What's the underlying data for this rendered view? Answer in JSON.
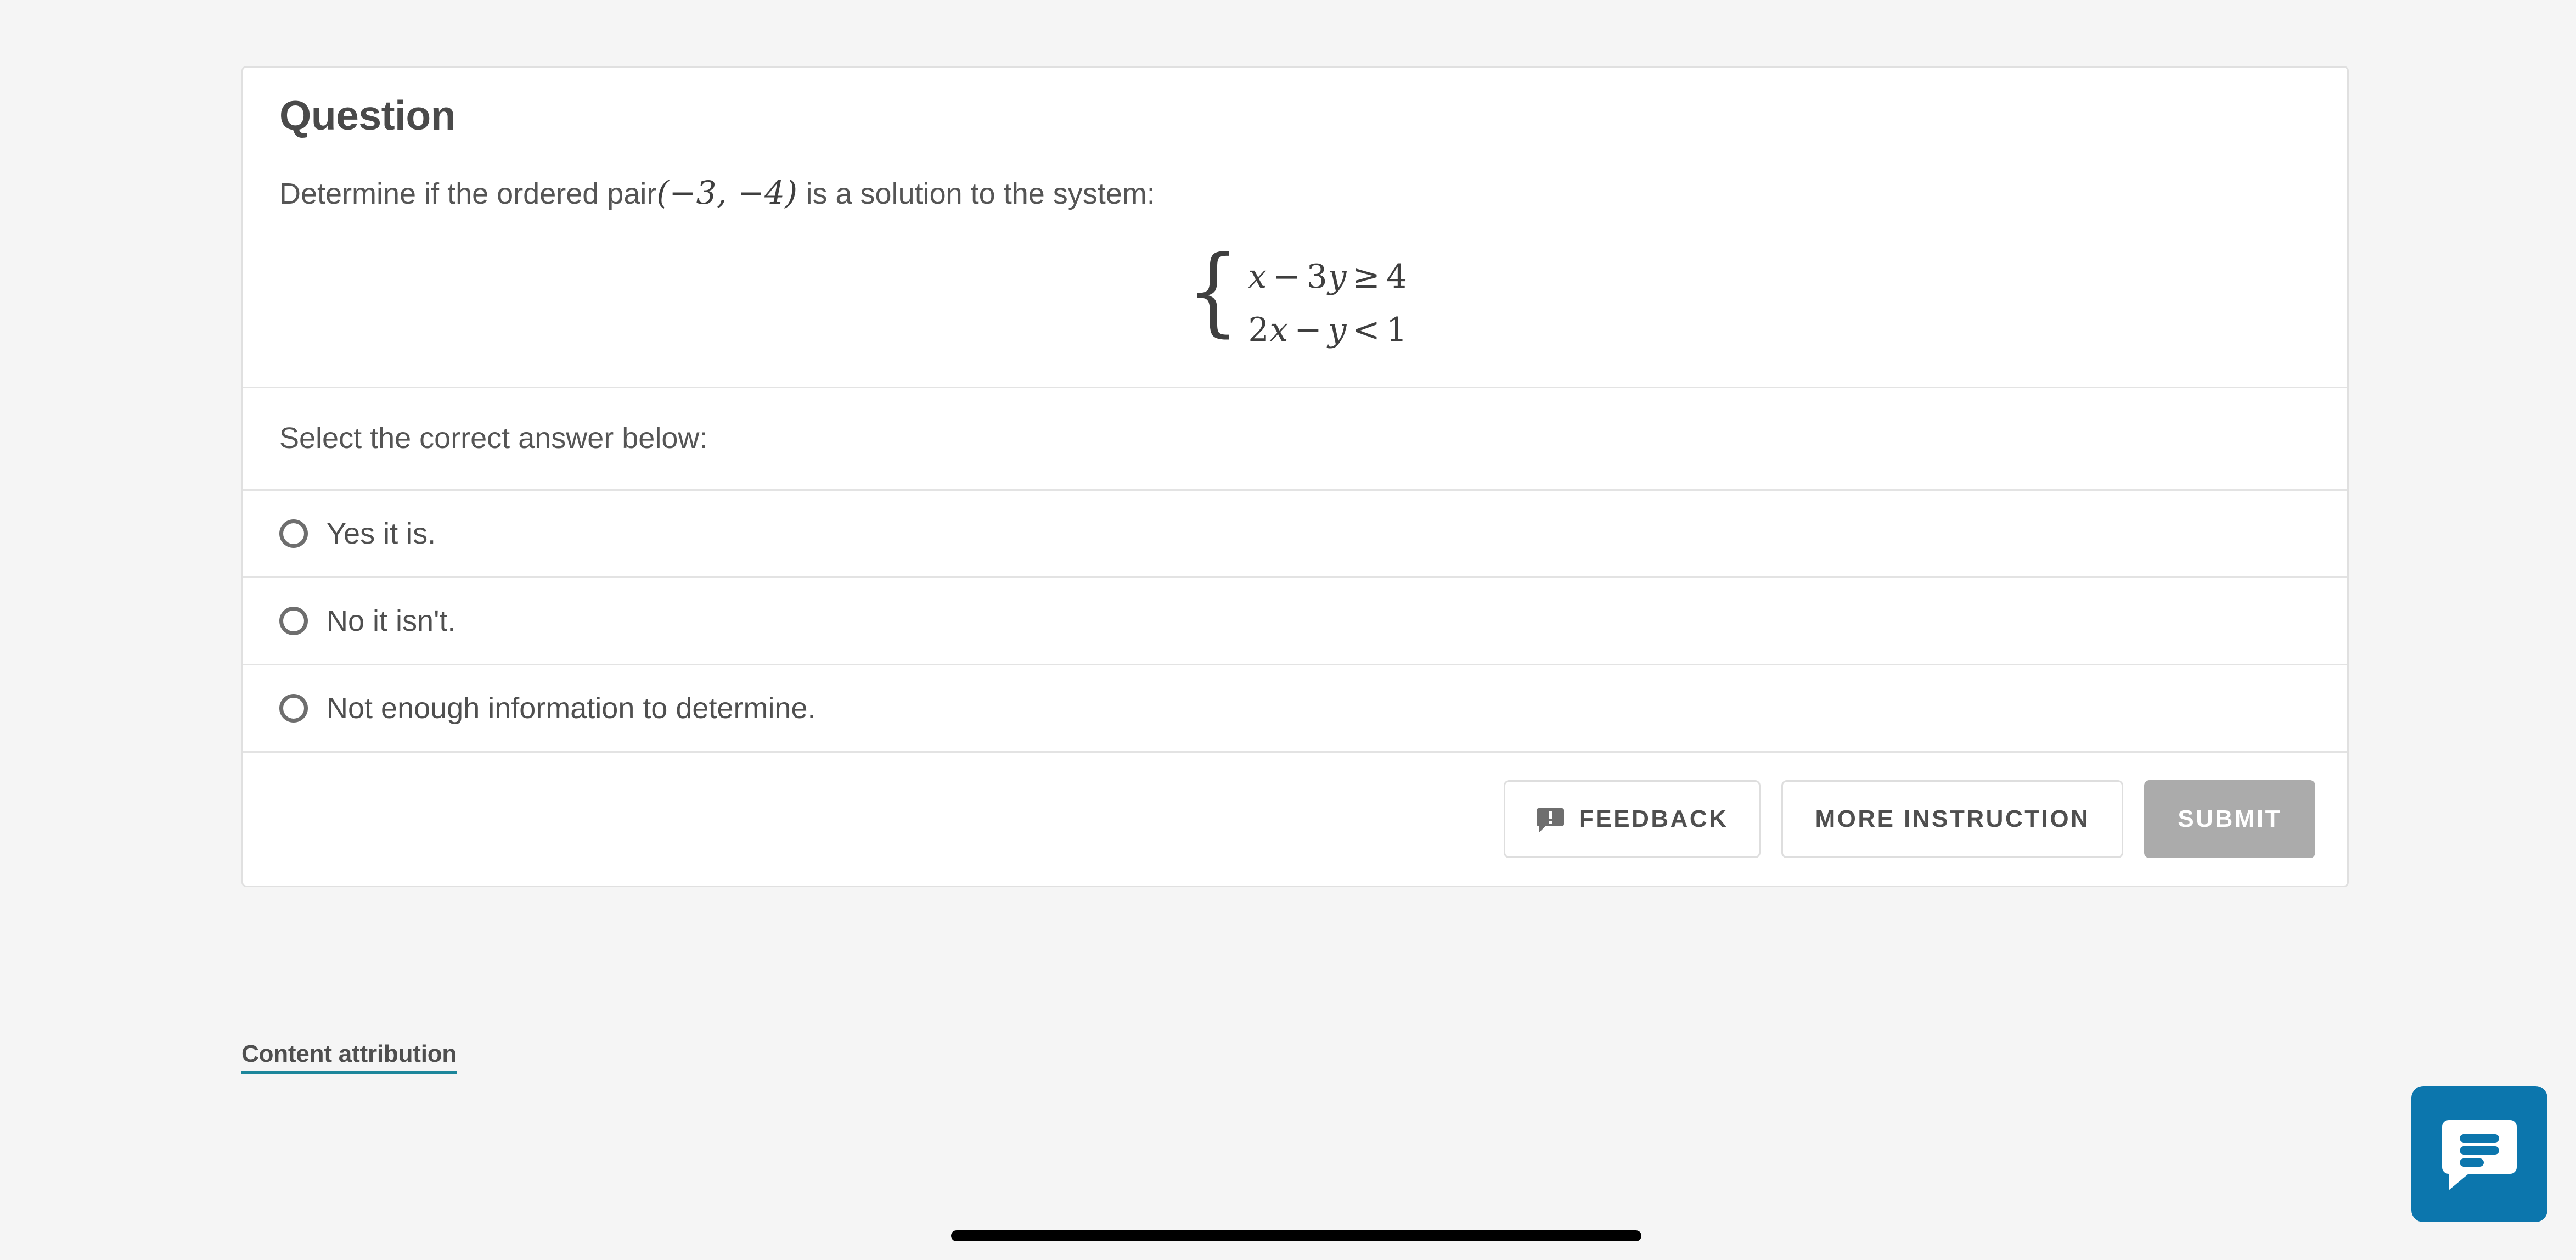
{
  "page": {
    "background_color": "#f5f5f5"
  },
  "card": {
    "title": "Question",
    "prompt": {
      "lead": "Determine if the ordered pair",
      "ordered_pair": "(−3, −4)",
      "tail": "is a solution to the system:"
    },
    "system": {
      "brace": "{",
      "equations": [
        {
          "lhs_var1": "x",
          "op1": "−",
          "coef2": "3",
          "var2": "y",
          "relation": "≥",
          "rhs": "4",
          "text": "x − 3y ≥ 4"
        },
        {
          "coef1": "2",
          "lhs_var1": "x",
          "op1": "−",
          "var2": "y",
          "relation": "<",
          "rhs": "1",
          "text": "2x − y < 1"
        }
      ]
    },
    "select_label": "Select the correct answer below:",
    "options": [
      {
        "label": "Yes it is.",
        "selected": false
      },
      {
        "label": "No it isn't.",
        "selected": false
      },
      {
        "label": "Not enough information to determine.",
        "selected": false
      }
    ],
    "actions": {
      "feedback_label": "FEEDBACK",
      "feedback_icon": "speech-bubble-alert-icon",
      "more_instruction_label": "MORE INSTRUCTION",
      "submit_label": "SUBMIT",
      "submit_color": "#ababab"
    }
  },
  "attribution": {
    "label": "Content attribution",
    "underline_color": "#1c869b"
  },
  "chat": {
    "icon": "chat-bubble-icon",
    "color": "#0c76ad"
  }
}
